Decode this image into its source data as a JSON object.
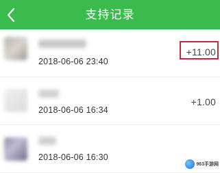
{
  "nav": {
    "title": "支持记录",
    "back_icon": "chevron-left-icon",
    "background": "#3bbb4d"
  },
  "records": [
    {
      "time": "2018-06-06 23:40",
      "amount": "+11.00",
      "highlighted": true
    },
    {
      "time": "2018-06-06 16:34",
      "amount": "+1.00",
      "highlighted": false
    },
    {
      "time": "2018-06-06 16:30",
      "amount": "",
      "highlighted": false
    }
  ],
  "highlight_color": "#c8283a",
  "watermark": {
    "text": "963手游网"
  }
}
